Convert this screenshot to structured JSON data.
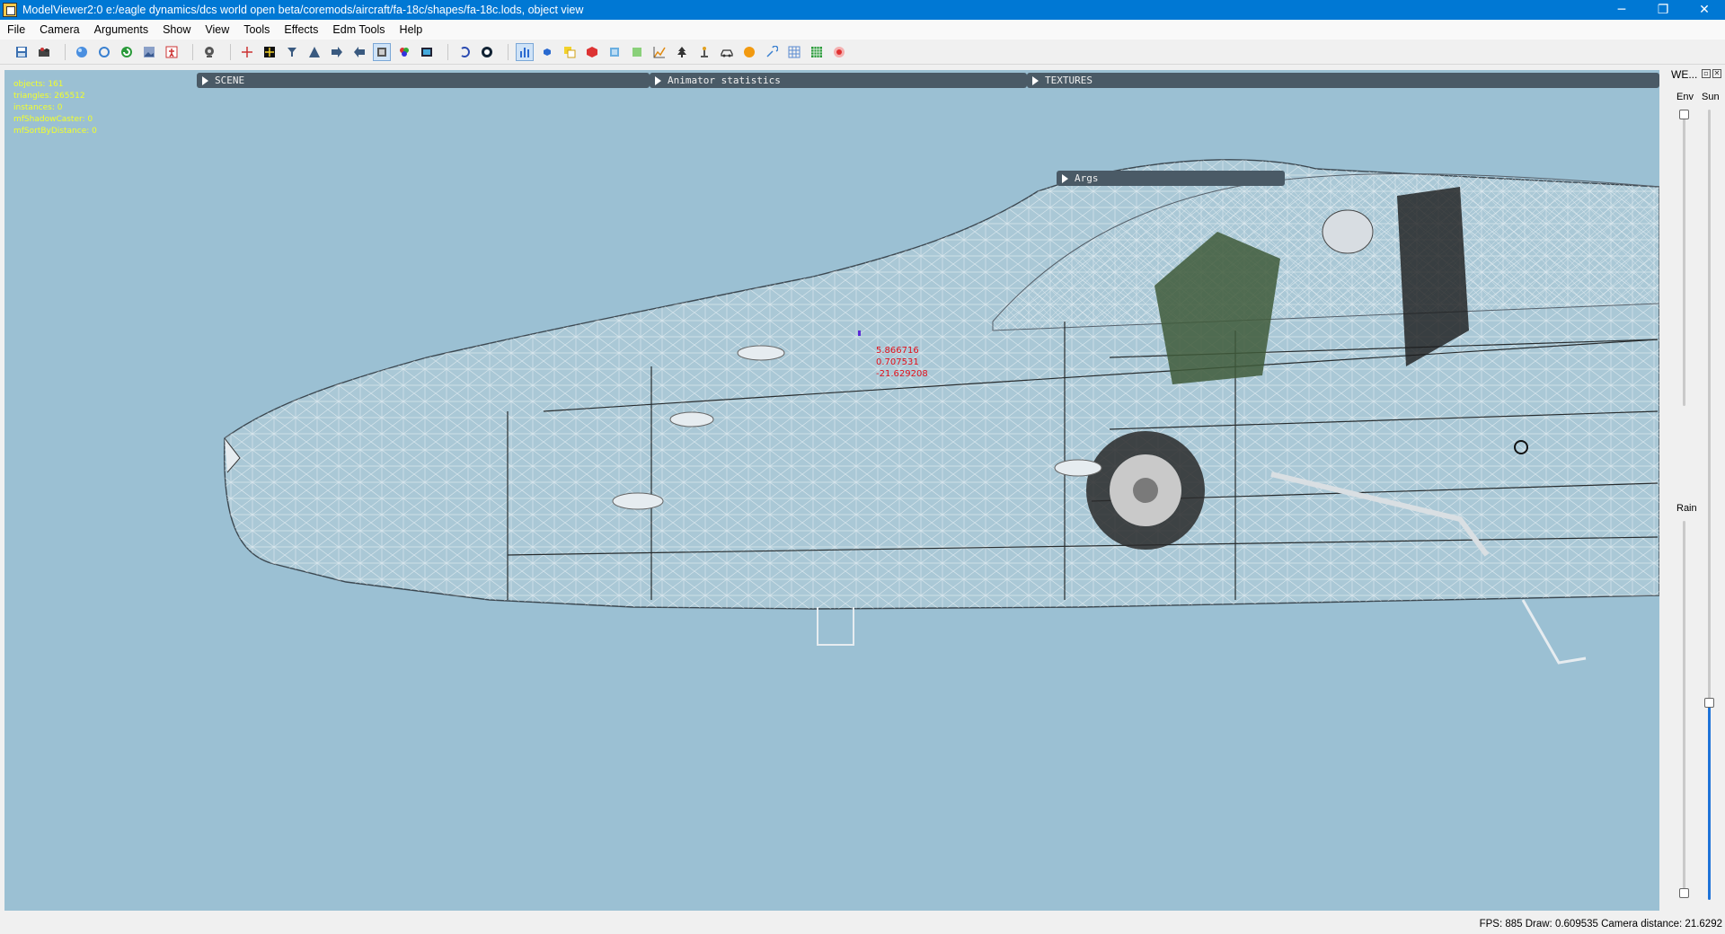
{
  "window": {
    "title": "ModelViewer2:0 e:/eagle dynamics/dcs world open beta/coremods/aircraft/fa-18c/shapes/fa-18c.lods, object view",
    "minimize": "─",
    "maximize": "❐",
    "close": "✕"
  },
  "menu": [
    "File",
    "Camera",
    "Arguments",
    "Show",
    "View",
    "Tools",
    "Effects",
    "Edm Tools",
    "Help"
  ],
  "toolbar_icons": [
    "save-icon",
    "open-icon",
    "sphere-icon",
    "refresh-icon",
    "reload-icon",
    "image-icon",
    "person-icon",
    "camera-icon",
    "crosshair-icon",
    "grid-icon",
    "lamp-icon",
    "triangle-icon",
    "arrow-right-icon",
    "arrow-left-icon",
    "frame-icon",
    "color-cubes-icon",
    "film-icon",
    "undo-icon",
    "play-icon",
    "bar-chart-icon",
    "blue-cube-icon",
    "copy-icon",
    "red-box-icon",
    "cube-blue-icon",
    "green-cube-icon",
    "chart-line-icon",
    "tree-icon",
    "lamp-post-icon",
    "car-icon",
    "circle-orange-icon",
    "tool-icon",
    "table-icon",
    "dots-grid-icon",
    "record-icon"
  ],
  "stats": [
    "objects: 161",
    "triangles: 265512",
    "instances: 0",
    "mfShadowCaster: 0",
    "mfSortByDistance: 0"
  ],
  "panels": {
    "scene": "SCENE",
    "animator": "Animator statistics",
    "textures": "TEXTURES",
    "args": "Args"
  },
  "coords": [
    "5.866716",
    "0.707531",
    "-21.629208"
  ],
  "dock": {
    "title": "WE...",
    "env_label": "Env",
    "sun_label": "Sun",
    "rain_label": "Rain",
    "sun_level": 0.25
  },
  "status": "FPS: 885  Draw: 0.609535  Camera distance: 21.6292",
  "colors": {
    "viewport_bg": "#9bc0d3",
    "stats_text": "#f2ff2a",
    "coords_text": "#e0101a",
    "titlebar": "#0078d4",
    "slider_fill": "#1e73d8"
  }
}
